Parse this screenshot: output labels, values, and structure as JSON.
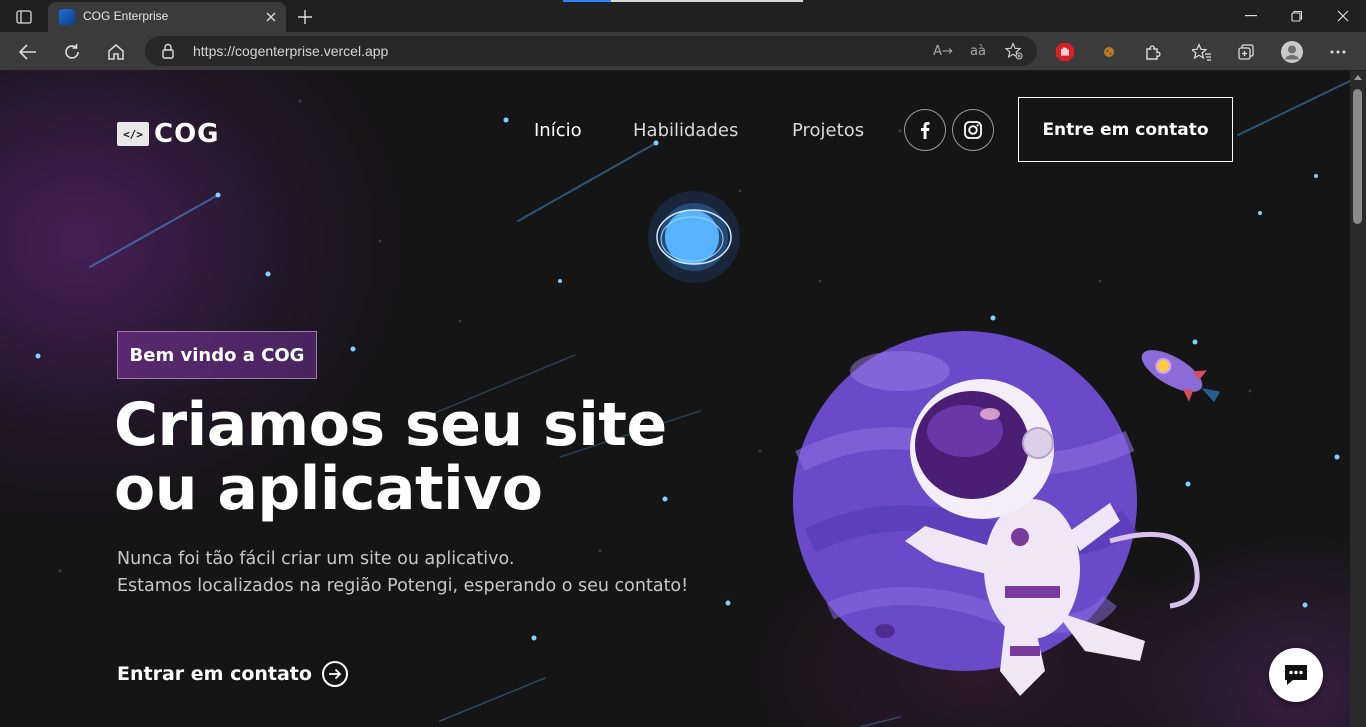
{
  "browser": {
    "tab_title": "COG Enterprise",
    "url": "https://cogenterprise.vercel.app",
    "read_aloud_glyph": "A→",
    "translate_glyph": "aà"
  },
  "site": {
    "logo_glyph": "</>",
    "logo_text": "COG",
    "nav": {
      "inicio": "Início",
      "habilidades": "Habilidades",
      "projetos": "Projetos"
    },
    "cta_label": "Entre em contato",
    "welcome_badge": "Bem vindo a COG",
    "headline": "Criamos seu site ou aplicativo",
    "subtext_line1": "Nunca foi tão fácil criar um site ou aplicativo.",
    "subtext_line2": "Estamos localizados na região Potengi, esperando o seu contato!",
    "contact_link": "Entrar em contato"
  },
  "icons": {
    "social": [
      "facebook-icon",
      "instagram-icon"
    ],
    "chat": "chat-icon"
  },
  "colors": {
    "accent_purple": "#5a2870",
    "page_bg": "#151515",
    "star_blue": "#7fd3ff"
  }
}
